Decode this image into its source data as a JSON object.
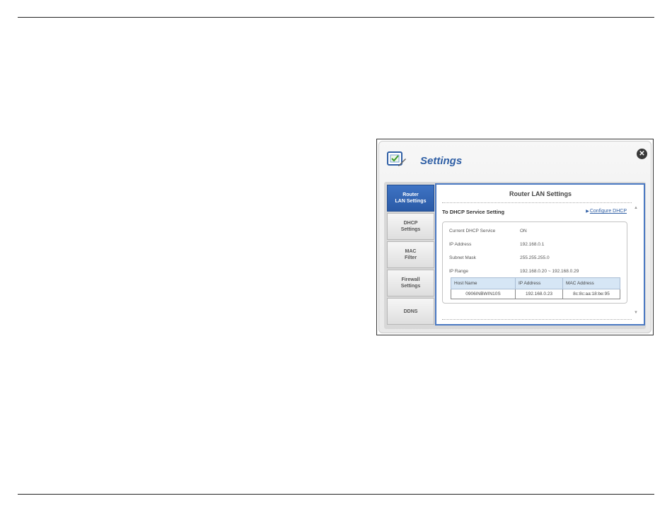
{
  "window": {
    "title": "Settings",
    "close_glyph": "✕",
    "icon": "settings-checkbox-icon"
  },
  "tabs": [
    {
      "label": "Router\nLAN Settings",
      "active": true
    },
    {
      "label": "DHCP\nSettings",
      "active": false
    },
    {
      "label": "MAC\nFilter",
      "active": false
    },
    {
      "label": "Firewall\nSettings",
      "active": false
    },
    {
      "label": "DDNS",
      "active": false
    }
  ],
  "content": {
    "title": "Router LAN Settings",
    "section_title": "To DHCP Service Setting",
    "configure_link": "Configure DHCP",
    "fields": [
      {
        "label": "Current DHCP Service",
        "value": "ON"
      },
      {
        "label": "IP Address",
        "value": "192.168.0.1"
      },
      {
        "label": "Subnet Mask",
        "value": "255.255.255.0"
      },
      {
        "label": "IP Range",
        "value": "192.168.0.20 ~ 192.168.0.29"
      }
    ],
    "hosts_table": {
      "headers": [
        "Host Name",
        "IP Address",
        "MAC Address"
      ],
      "rows": [
        [
          "0906INBWIN10S",
          "192.168.0.23",
          "8c:8c:aa:18:be:95"
        ]
      ]
    }
  },
  "colors": {
    "accent": "#2f5fa5",
    "active_tab": "#3e73c4",
    "table_header": "#d6e6f5"
  }
}
